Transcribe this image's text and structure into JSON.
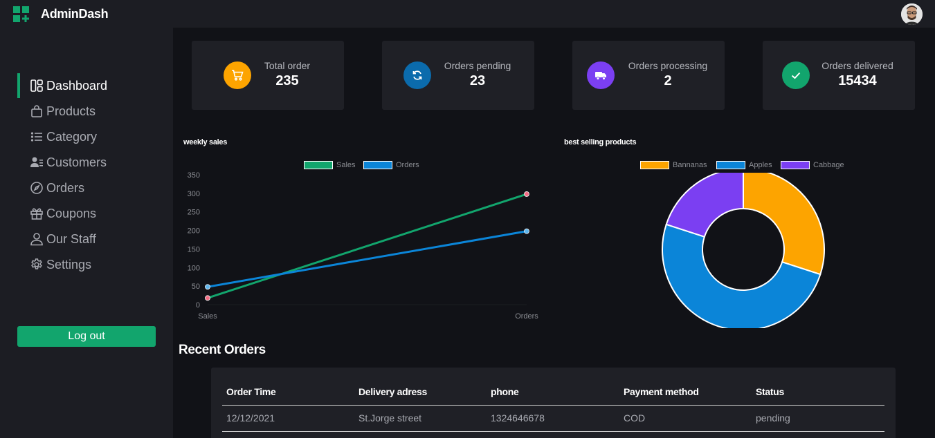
{
  "app": {
    "name": "AdminDash"
  },
  "colors": {
    "accent": "#12a56d",
    "surface": "#1f2026",
    "background": "#111217"
  },
  "sidebar": {
    "items": [
      {
        "label": "Dashboard",
        "icon": "dashboard-icon",
        "active": true
      },
      {
        "label": "Products",
        "icon": "shopping-bag-icon"
      },
      {
        "label": "Category",
        "icon": "list-icon"
      },
      {
        "label": "Customers",
        "icon": "users-icon"
      },
      {
        "label": "Orders",
        "icon": "compass-icon"
      },
      {
        "label": "Coupons",
        "icon": "gift-icon"
      },
      {
        "label": "Our Staff",
        "icon": "user-icon"
      },
      {
        "label": "Settings",
        "icon": "gear-icon"
      }
    ],
    "logout_label": "Log out"
  },
  "stats": [
    {
      "label": "Total order",
      "value": "235",
      "icon": "cart-icon",
      "color": "#fda400"
    },
    {
      "label": "Orders pending",
      "value": "23",
      "icon": "refresh-icon",
      "color": "#0b6bac"
    },
    {
      "label": "Orders processing",
      "value": "2",
      "icon": "truck-icon",
      "color": "#7b3ff2"
    },
    {
      "label": "Orders delivered",
      "value": "15434",
      "icon": "check-icon",
      "color": "#12a56d"
    }
  ],
  "chart_data": [
    {
      "type": "line",
      "title": "weekly sales",
      "x": [
        "Sales",
        "Orders"
      ],
      "series": [
        {
          "name": "Sales",
          "values": [
            18,
            298
          ],
          "color": "#12a56d"
        },
        {
          "name": "Orders",
          "values": [
            48,
            198
          ],
          "color": "#0b85d8"
        }
      ],
      "ylim": [
        0,
        350
      ],
      "yticks": [
        0,
        50,
        100,
        150,
        200,
        250,
        300,
        350
      ],
      "legend": "top",
      "grid": false
    },
    {
      "type": "pie",
      "title": "best selling products",
      "categories": [
        "Bannanas",
        "Apples",
        "Cabbage"
      ],
      "values": [
        30,
        50,
        20
      ],
      "colors": [
        "#fda400",
        "#0b85d8",
        "#7b3ff2"
      ],
      "donut": true,
      "legend": "top"
    }
  ],
  "recent_orders": {
    "title": "Recent Orders",
    "columns": [
      "Order Time",
      "Delivery adress",
      "phone",
      "Payment method",
      "Status"
    ],
    "rows": [
      [
        "12/12/2021",
        "St.Jorge street",
        "1324646678",
        "COD",
        "pending"
      ]
    ]
  }
}
